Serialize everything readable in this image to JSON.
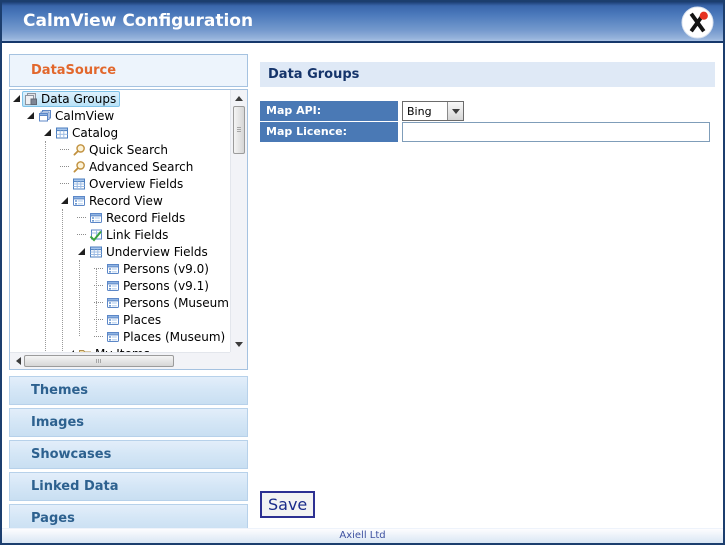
{
  "window": {
    "title": "CalmView Configuration",
    "logo": "axiell-logo"
  },
  "sidebar": {
    "panel_title": "DataSource",
    "tree": {
      "items": [
        {
          "label": "Data Groups",
          "icon": "datagroups",
          "indent": 0,
          "marker": "expander",
          "selected": true
        },
        {
          "label": "CalmView",
          "icon": "stack",
          "indent": 14,
          "marker": "expander",
          "selected": false
        },
        {
          "label": "Catalog",
          "icon": "table",
          "indent": 31,
          "marker": "expander",
          "selected": false
        },
        {
          "label": "Quick Search",
          "icon": "search",
          "indent": 48,
          "marker": "dots",
          "selected": false
        },
        {
          "label": "Advanced Search",
          "icon": "search",
          "indent": 48,
          "marker": "dots",
          "selected": false
        },
        {
          "label": "Overview Fields",
          "icon": "grid",
          "indent": 48,
          "marker": "dots",
          "selected": false
        },
        {
          "label": "Record View",
          "icon": "form",
          "indent": 48,
          "marker": "expander",
          "selected": false
        },
        {
          "label": "Record Fields",
          "icon": "form",
          "indent": 65,
          "marker": "dots",
          "selected": false
        },
        {
          "label": "Link Fields",
          "icon": "link",
          "indent": 65,
          "marker": "dots",
          "selected": false
        },
        {
          "label": "Underview Fields",
          "icon": "grid",
          "indent": 65,
          "marker": "expander",
          "selected": false
        },
        {
          "label": "Persons (v9.0)",
          "icon": "form",
          "indent": 82,
          "marker": "dots",
          "selected": false
        },
        {
          "label": "Persons (v9.1)",
          "icon": "form",
          "indent": 82,
          "marker": "dots",
          "selected": false
        },
        {
          "label": "Persons (Museum)",
          "icon": "form",
          "indent": 82,
          "marker": "dots",
          "selected": false
        },
        {
          "label": "Places",
          "icon": "form",
          "indent": 82,
          "marker": "dots",
          "selected": false
        },
        {
          "label": "Places (Museum)",
          "icon": "form",
          "indent": 82,
          "marker": "dots",
          "selected": false
        },
        {
          "label": "My Items",
          "icon": "folder",
          "indent": 54,
          "marker": "expander",
          "selected": false
        }
      ]
    },
    "sections": [
      {
        "label": "Themes"
      },
      {
        "label": "Images"
      },
      {
        "label": "Showcases"
      },
      {
        "label": "Linked Data"
      },
      {
        "label": "Pages"
      }
    ]
  },
  "content": {
    "header": "Data Groups",
    "form": {
      "fields": [
        {
          "label": "Map API:",
          "type": "select",
          "value": "Bing"
        },
        {
          "label": "Map Licence:",
          "type": "text",
          "value": "",
          "placeholder": ""
        }
      ]
    },
    "save_label": "Save"
  },
  "footer": {
    "text": "Axiell Ltd"
  },
  "colors": {
    "title_bar_blue": "#4a77b8",
    "accent_orange": "#e2672c",
    "form_label_blue": "#4a79b5",
    "header_navy": "#15346a",
    "section_text_blue": "#2d618f",
    "selection_blue": "#b8e2f7",
    "selection_border": "#7fc3e8",
    "logo_dot_red": "#e63222"
  }
}
